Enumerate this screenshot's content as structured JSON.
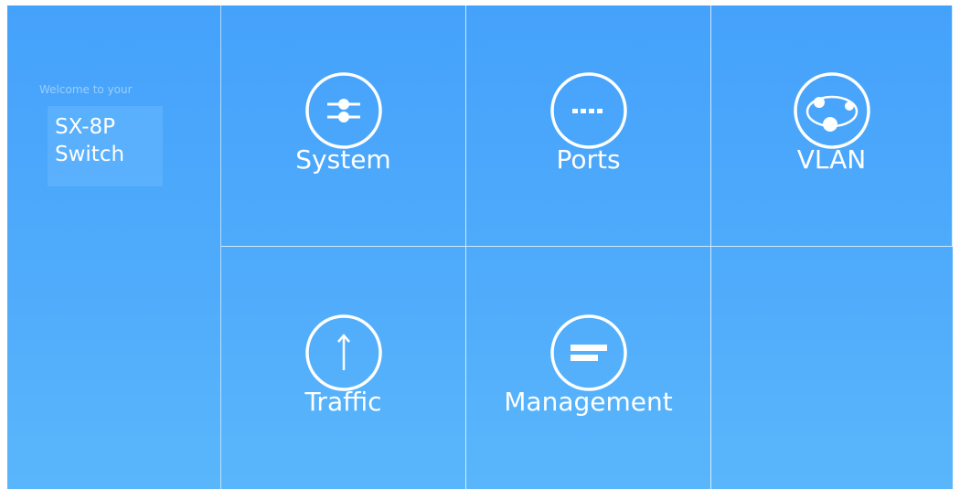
{
  "sidebar": {
    "welcome_text": "Welcome to your",
    "device_name": "SX-8P\nSwitch"
  },
  "tiles": [
    {
      "label": "System",
      "icon": "sliders-icon"
    },
    {
      "label": "Ports",
      "icon": "ports-icon"
    },
    {
      "label": "VLAN",
      "icon": "vlan-network-icon"
    },
    {
      "label": "Traffic",
      "icon": "arrow-up-icon"
    },
    {
      "label": "Management",
      "icon": "management-icon"
    }
  ],
  "colors": {
    "background_top": "#45a2fb",
    "background_bottom": "#5ab6fb",
    "foreground": "#ffffff"
  }
}
